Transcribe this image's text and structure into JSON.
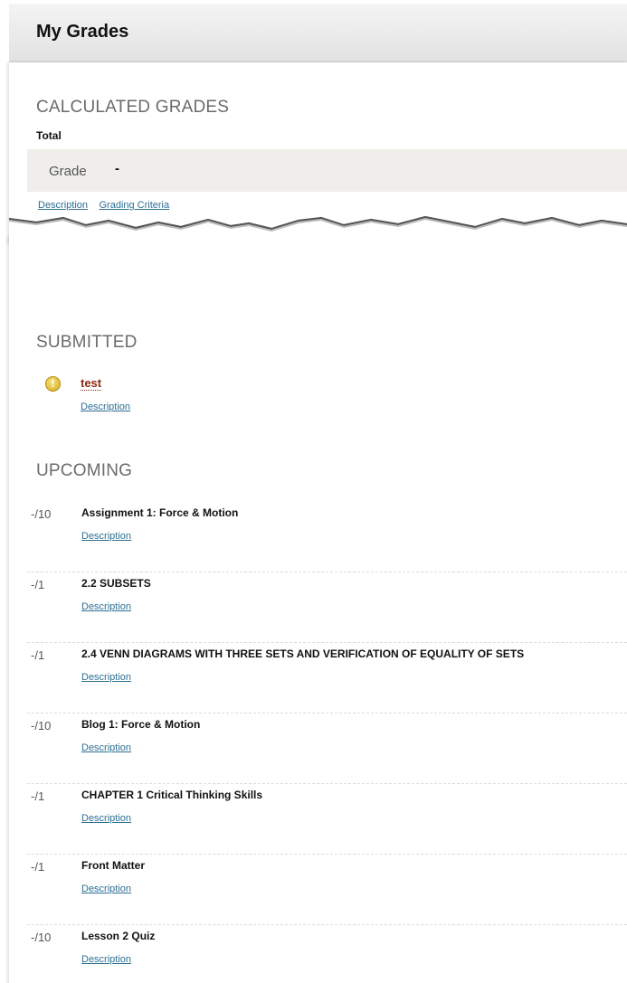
{
  "page": {
    "title": "My Grades"
  },
  "calculated": {
    "heading": "CALCULATED GRADES",
    "total_label": "Total",
    "grade_label": "Grade",
    "grade_value": "-",
    "links": [
      "Description",
      "Grading Criteria"
    ]
  },
  "submitted": {
    "heading": "SUBMITTED",
    "item": {
      "title": "test",
      "icon": "warning-icon",
      "link": "Description"
    }
  },
  "upcoming": {
    "heading": "UPCOMING",
    "items": [
      {
        "score": "-/10",
        "title": "Assignment 1: Force & Motion",
        "link": "Description"
      },
      {
        "score": "-/1",
        "title": "2.2 SUBSETS",
        "link": "Description"
      },
      {
        "score": "-/1",
        "title": "2.4 VENN DIAGRAMS WITH THREE SETS AND VERIFICATION OF EQUALITY OF SETS",
        "link": "Description"
      },
      {
        "score": "-/10",
        "title": "Blog 1: Force & Motion",
        "link": "Description"
      },
      {
        "score": "-/1",
        "title": "CHAPTER 1 Critical Thinking Skills",
        "link": "Description"
      },
      {
        "score": "-/1",
        "title": "Front Matter",
        "link": "Description"
      },
      {
        "score": "-/10",
        "title": "Lesson 2 Quiz",
        "link": "Description"
      }
    ]
  }
}
